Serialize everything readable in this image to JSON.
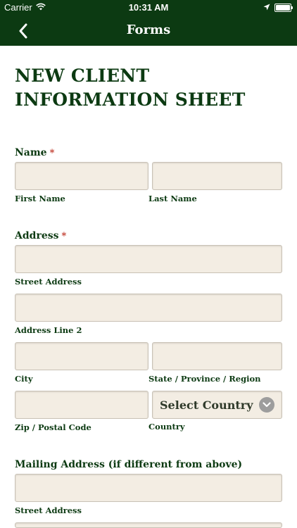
{
  "status_bar": {
    "carrier": "Carrier",
    "time": "10:31 AM"
  },
  "nav": {
    "title": "Forms"
  },
  "form": {
    "title": "NEW CLIENT INFORMATION SHEET",
    "name_section": {
      "label": "Name",
      "required_mark": "*",
      "first_name_label": "First Name",
      "last_name_label": "Last Name"
    },
    "address_section": {
      "label": "Address",
      "required_mark": "*",
      "street_label": "Street Address",
      "line2_label": "Address Line 2",
      "city_label": "City",
      "state_label": "State / Province / Region",
      "zip_label": "Zip / Postal Code",
      "country_label": "Country",
      "country_select_value": "Select Country"
    },
    "mailing_section": {
      "label": "Mailing Address (if different from above)",
      "street_label": "Street Address"
    }
  },
  "colors": {
    "header_green": "#0c3a12",
    "field_bg": "#f3ede3",
    "required_red": "#c0392b"
  },
  "icons": {
    "back": "chevron-left-icon",
    "wifi": "wifi-icon",
    "location": "location-arrow-icon",
    "battery": "battery-icon",
    "dropdown": "chevron-down-icon"
  }
}
